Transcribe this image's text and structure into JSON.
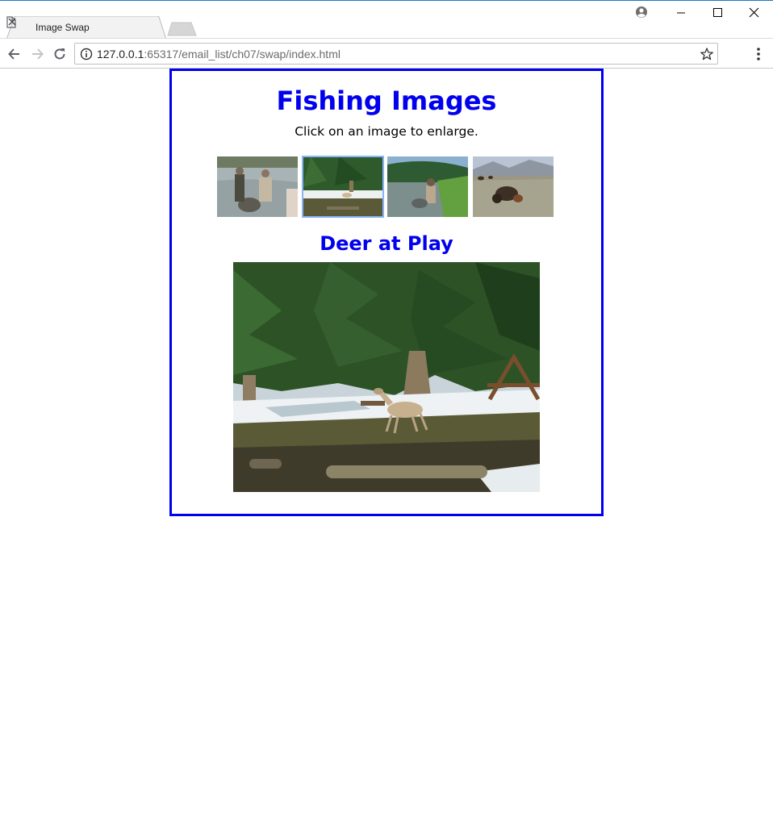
{
  "browser": {
    "tab_title": "Image Swap",
    "url_host": "127.0.0.1",
    "url_rest": ":65317/email_list/ch07/swap/index.html",
    "icons": {
      "tab": "file-icon",
      "close": "close-icon",
      "account": "account-icon",
      "minimize": "minimize-icon",
      "maximize": "maximize-icon",
      "window_close": "window-close-icon",
      "back": "back-arrow-icon",
      "forward": "forward-arrow-icon",
      "reload": "reload-icon",
      "info": "info-icon",
      "bookmark": "star-icon",
      "menu": "more-vert-icon"
    }
  },
  "page": {
    "title": "Fishing Images",
    "instructions": "Click on an image to enlarge.",
    "caption": "Deer at Play",
    "accent_color": "#0000ee",
    "thumbnails": [
      {
        "subject": "two fishermen netting a fish in river",
        "selected": false
      },
      {
        "subject": "deer under pine trees",
        "selected": true
      },
      {
        "subject": "fisherman wading in stream",
        "selected": false
      },
      {
        "subject": "bison in meadow",
        "selected": false
      }
    ]
  }
}
